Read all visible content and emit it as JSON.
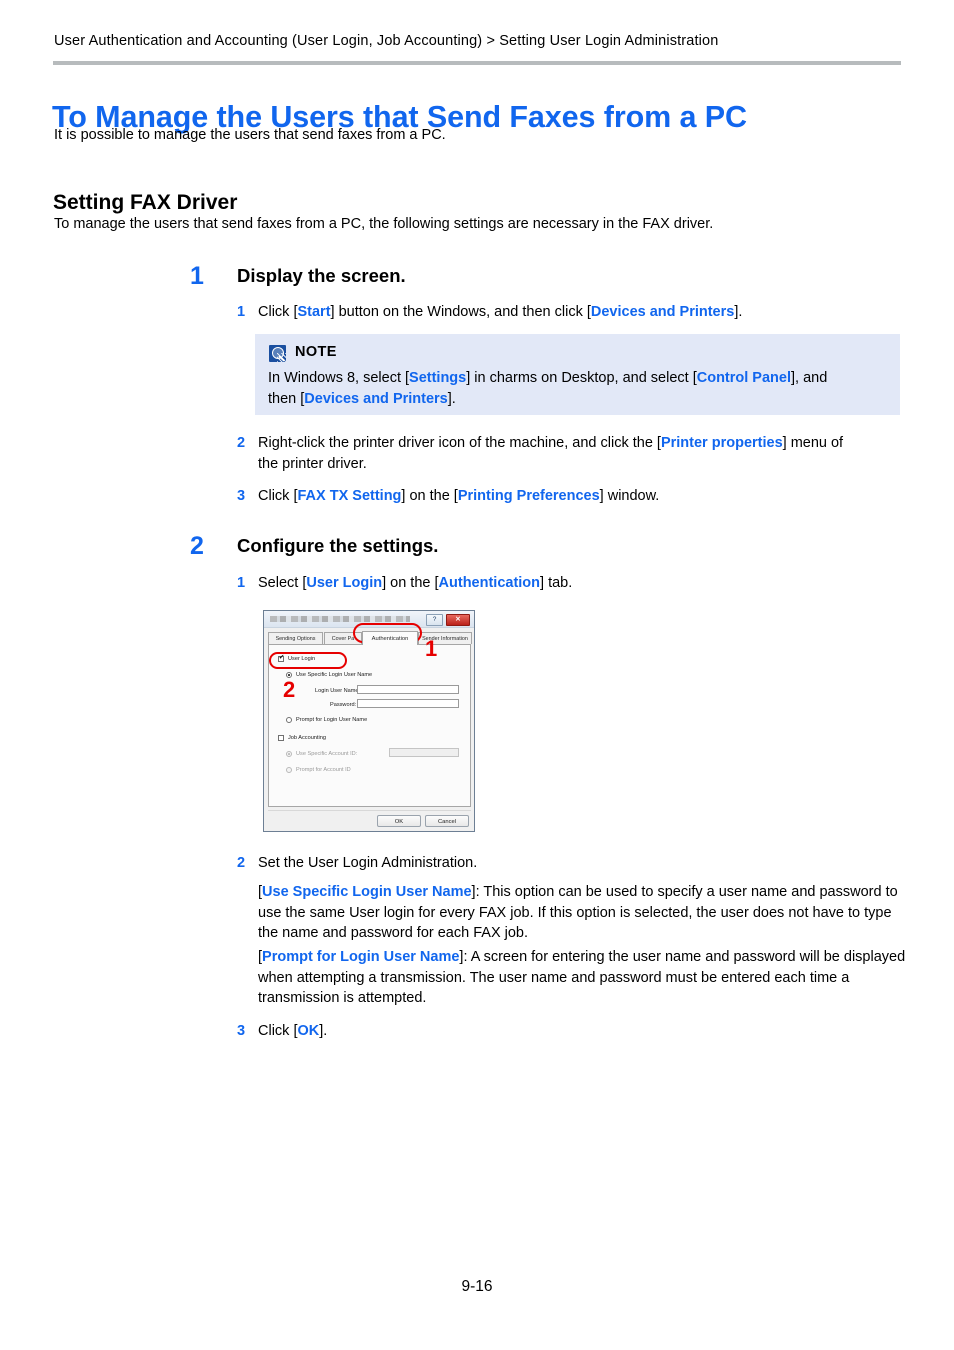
{
  "header": {
    "breadcrumb": "User Authentication and Accounting (User Login, Job Accounting) > Setting User Login Administration"
  },
  "title": "To Manage the Users that Send Faxes from a PC",
  "intro": "It is possible to manage the users that send faxes from a PC.",
  "section": {
    "heading": "Setting FAX Driver",
    "intro": "To manage the users that send faxes from a PC, the following settings are necessary in the FAX driver."
  },
  "steps": [
    {
      "number": "1",
      "title": "Display the screen.",
      "substeps": [
        {
          "number": "1",
          "text_parts": [
            "Click [",
            "Start",
            "] button on the Windows, and then click [",
            "Devices and Printers",
            "]."
          ]
        }
      ]
    },
    {
      "number": "2",
      "title": "Configure the settings.",
      "substeps": [
        {
          "number": "1",
          "text_parts": [
            "Select [",
            "User Login",
            "] on the [",
            "Authentication",
            "] tab."
          ]
        }
      ]
    }
  ],
  "note": {
    "icon": "magnifier-note-icon",
    "label": "NOTE",
    "line1_a": "In Windows 8, select [",
    "line1_link1": "Settings",
    "line1_b": "] in charms on Desktop, and select [",
    "line1_link2": "Control Panel",
    "line1_c": "], and",
    "line2_a": "then [",
    "line2_link": "Devices and Printers",
    "line2_b": "]."
  },
  "substep_1_2": {
    "number": "2",
    "a": "Right-click the printer driver icon of the machine, and click the [",
    "link": "Printer properties",
    "b": "] menu of",
    "c": "the printer driver."
  },
  "substep_1_3": {
    "number": "3",
    "a": "Click [",
    "link1": "FAX TX Setting",
    "b": "] on the [",
    "link2": "Printing Preferences",
    "c": "] window."
  },
  "substep_2_2": {
    "number": "2",
    "text": "Set the User Login Administration."
  },
  "paragraphs": {
    "use_specific": {
      "link": "Use Specific Login User Name",
      "l1": "]: This option can be used to specify a user name and password to",
      "l2": "use the same User login for every FAX job. If this option is selected, the user does not have to type",
      "l3": "the name and password for each FAX job.",
      "open": "["
    },
    "prompt_for": {
      "open": "[",
      "link": "Prompt for Login User Name",
      "l1": "]: A screen for entering the user name and password will be displayed",
      "l2": "when attempting a transmission. The user name and password must be entered each time a",
      "l3": "transmission is attempted."
    }
  },
  "substep_2_3": {
    "number": "3",
    "a": "Click [",
    "link": "OK",
    "b": "]."
  },
  "dialog": {
    "titlebar": {
      "help_button": "?",
      "close_button": "✕"
    },
    "tabs": [
      {
        "label": "Sending Options",
        "active": false
      },
      {
        "label": "Cover Pa",
        "active": false
      },
      {
        "label": "Authentication",
        "active": true
      },
      {
        "label": "Sender Information",
        "active": false
      }
    ],
    "user_login_checkbox": "User Login",
    "use_specific_radio": "Use Specific Login User Name",
    "login_user_name_label": "Login User Name:",
    "login_user_name_value": "",
    "password_label": "Password:",
    "password_value": "",
    "prompt_login_radio": "Prompt for Login User Name",
    "job_accounting_checkbox": "Job Accounting",
    "use_specific_account_radio": "Use Specific Account ID:",
    "account_id_value": "",
    "prompt_account_radio": "Prompt for Account ID",
    "ok_button": "OK",
    "cancel_button": "Cancel",
    "annotations": [
      {
        "number": "1"
      },
      {
        "number": "2"
      }
    ]
  },
  "footer": {
    "page_number": "9-16"
  },
  "colors": {
    "link_blue": "#1166ee",
    "rule_gray": "#b7bbbd",
    "note_bg": "#e2e8f7",
    "annotation_red": "#e60000"
  }
}
